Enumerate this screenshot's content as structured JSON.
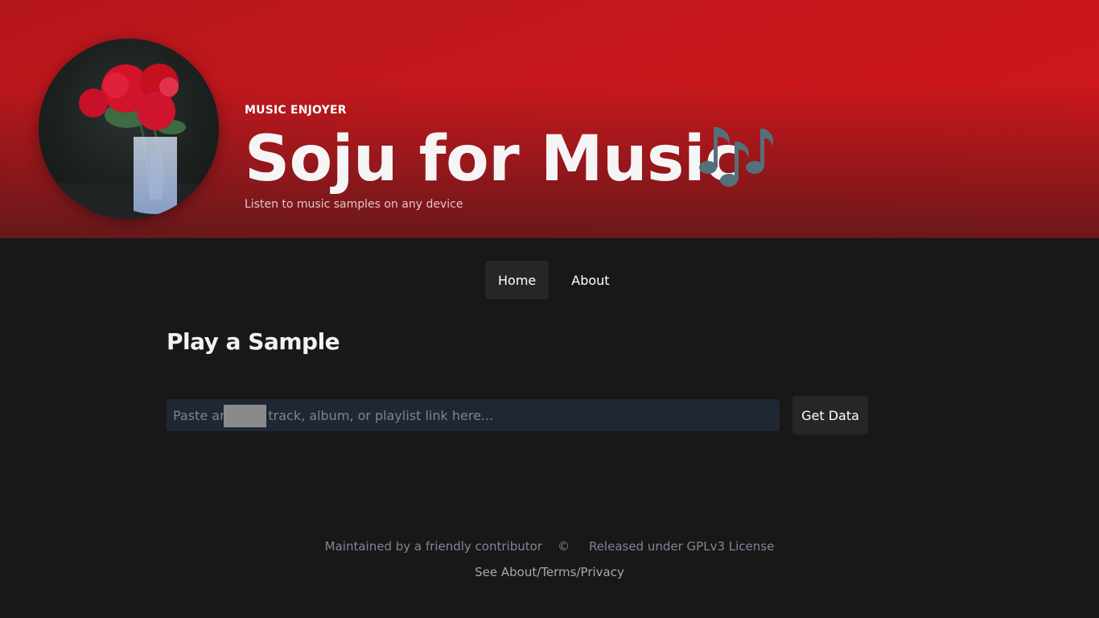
{
  "hero": {
    "eyebrow": "MUSIC ENJOYER",
    "title": "Soju for Music",
    "subtitle": "Listen to music samples on any device",
    "accent_color": "#c8171c"
  },
  "nav": {
    "items": [
      {
        "label": "Home",
        "active": true
      },
      {
        "label": "About",
        "active": false
      }
    ]
  },
  "main": {
    "section_title": "Play a Sample",
    "search": {
      "placeholder": "Paste any        track, album, or playlist link here...",
      "value": ""
    },
    "get_data_label": "Get Data"
  },
  "footer": {
    "maintainer": "Maintained by a friendly contributor",
    "copyright_symbol": "©",
    "license": "Released under GPLv3 License",
    "links": "See About/Terms/Privacy"
  }
}
